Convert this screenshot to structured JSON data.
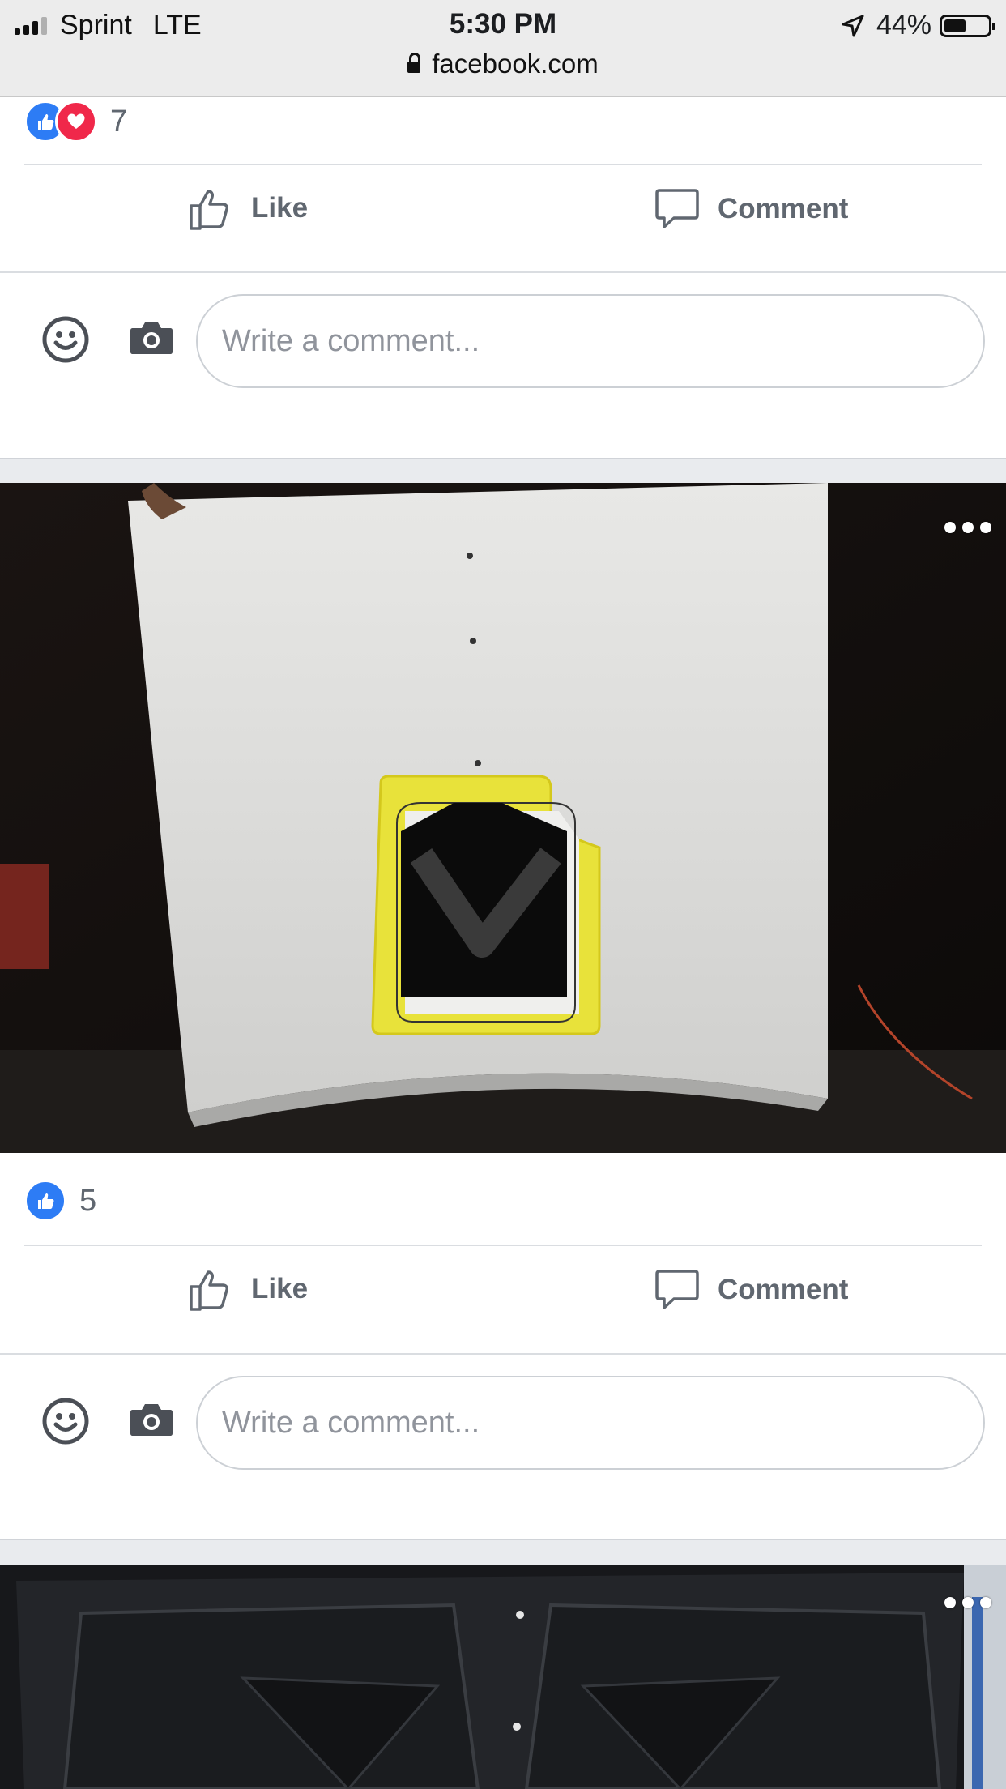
{
  "status_bar": {
    "carrier": "Sprint",
    "network": "LTE",
    "time": "5:30 PM",
    "battery": "44%",
    "battery_level": 0.44,
    "url": "facebook.com"
  },
  "posts": [
    {
      "reaction_count": "7",
      "reactions": [
        "like",
        "love"
      ],
      "like_label": "Like",
      "comment_label": "Comment",
      "comment_placeholder": "Write a comment..."
    },
    {
      "reaction_count": "5",
      "reactions": [
        "like"
      ],
      "like_label": "Like",
      "comment_label": "Comment",
      "comment_placeholder": "Write a comment...",
      "image_description_icon": "photo-white-car-hood-with-taped-cutout"
    },
    {
      "image_description_icon": "photo-black-hood-underside"
    }
  ],
  "icons": {
    "like": "thumbs-up-icon",
    "love": "heart-icon",
    "comment": "speech-bubble-icon",
    "emoji": "smiley-icon",
    "camera": "camera-icon",
    "more": "more-dots-icon"
  },
  "colors": {
    "like_blue": "#2d7cf5",
    "love_red": "#f0284a",
    "action_gray": "#606770",
    "feed_bg": "#e9ebee"
  }
}
